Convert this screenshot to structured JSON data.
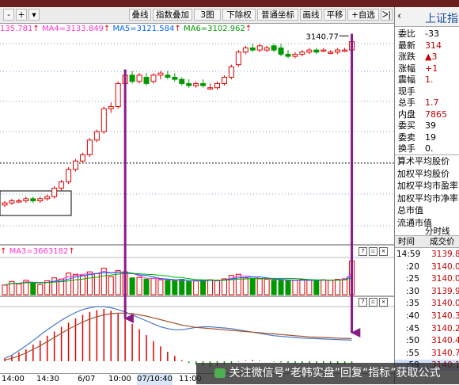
{
  "toolbar": {
    "minus": "-",
    "plus": "+",
    "buttons": [
      "叠线",
      "指数叠加",
      "3图",
      "下除权",
      "普通坐标",
      "画线",
      "平移",
      "+自选",
      "ᐳ|"
    ]
  },
  "legend": {
    "ma3": "135.781",
    "ma4": "MA4=3133.849",
    "ma5": "MA5=3121.584",
    "ma6": "MA6=3102.962",
    "high_label": "3140.77"
  },
  "volume_legend": {
    "ma3": "MA3=3663182"
  },
  "x_axis_labels": [
    "14:00",
    "14:30",
    "6/07",
    "10:00",
    "07/10:40",
    "11:00"
  ],
  "right_panel": {
    "title": "上证指",
    "rows": [
      {
        "label": "委比",
        "value": "-33"
      },
      {
        "label": "最新",
        "value": "314"
      },
      {
        "label": "涨跌",
        "value": "▲3"
      },
      {
        "label": "涨幅",
        "value": "+1"
      },
      {
        "label": "震幅",
        "value": "1."
      },
      {
        "label": "现手",
        "value": ""
      },
      {
        "label": "总手",
        "value": "1.7"
      },
      {
        "label": "内盘",
        "value": "7865"
      },
      {
        "label": "委买",
        "value": "39"
      },
      {
        "label": "委卖",
        "value": "19"
      },
      {
        "label": "换手",
        "value": "0."
      }
    ],
    "info": [
      "算术平均股价",
      "加权平均股价",
      "加权平均市盈率",
      "加权平均市净率",
      "总市值",
      "流通市值"
    ],
    "ticks_title": "分时线",
    "ticks_header": {
      "time": "时间",
      "price": "成交价"
    },
    "ticks": [
      {
        "time": "14:59",
        "price": "3139.8"
      },
      {
        "time": ":20",
        "price": "3140.0"
      },
      {
        "time": ":25",
        "price": "3140.0"
      },
      {
        "time": ":30",
        "price": "3139.9"
      },
      {
        "time": ":35",
        "price": "3140.0"
      },
      {
        "time": ":40",
        "price": "3140.3"
      },
      {
        "time": ":45",
        "price": "3140.2"
      },
      {
        "time": ":50",
        "price": "3140.4"
      },
      {
        "time": ":55",
        "price": "3140.7"
      },
      {
        "time": ":59",
        "price": "3140.1"
      }
    ]
  },
  "watermark": {
    "text": "关注微信号“老韩实盘”回复“指标”获取公式"
  },
  "colors": {
    "up": "#e00000",
    "down": "#009a00",
    "ma_pink": "#ff33cc",
    "ma_blue": "#0066ff",
    "ma_green": "#00aa00",
    "arrow": "#8a1a8a"
  },
  "chart_data": {
    "type": "candlestick",
    "candles": [
      [
        3060,
        3062,
        3059,
        3061
      ],
      [
        3061,
        3063,
        3060,
        3062
      ],
      [
        3062,
        3063,
        3061,
        3062
      ],
      [
        3062,
        3064,
        3061,
        3063
      ],
      [
        3063,
        3064,
        3061,
        3062
      ],
      [
        3062,
        3064,
        3061,
        3063
      ],
      [
        3063,
        3065,
        3062,
        3064
      ],
      [
        3064,
        3069,
        3063,
        3068
      ],
      [
        3068,
        3072,
        3067,
        3071
      ],
      [
        3071,
        3078,
        3070,
        3077
      ],
      [
        3077,
        3082,
        3076,
        3081
      ],
      [
        3081,
        3085,
        3080,
        3084
      ],
      [
        3084,
        3092,
        3083,
        3091
      ],
      [
        3091,
        3096,
        3090,
        3095
      ],
      [
        3095,
        3107,
        3094,
        3106
      ],
      [
        3106,
        3109,
        3104,
        3107
      ],
      [
        3107,
        3119,
        3106,
        3118
      ],
      [
        3118,
        3124,
        3116,
        3122
      ],
      [
        3122,
        3124,
        3118,
        3119
      ],
      [
        3119,
        3123,
        3118,
        3122
      ],
      [
        3121,
        3123,
        3117,
        3118
      ],
      [
        3119,
        3123,
        3118,
        3122
      ],
      [
        3122,
        3124,
        3120,
        3123
      ],
      [
        3122,
        3124,
        3120,
        3121
      ],
      [
        3121,
        3123,
        3119,
        3120
      ],
      [
        3120,
        3121,
        3117,
        3118
      ],
      [
        3118,
        3120,
        3116,
        3117
      ],
      [
        3117,
        3119,
        3116,
        3118
      ],
      [
        3118,
        3120,
        3116,
        3117
      ],
      [
        3116,
        3118,
        3115,
        3116
      ],
      [
        3116,
        3119,
        3115,
        3118
      ],
      [
        3118,
        3122,
        3117,
        3121
      ],
      [
        3121,
        3127,
        3120,
        3126
      ],
      [
        3127,
        3134,
        3126,
        3133
      ],
      [
        3133,
        3136,
        3132,
        3135
      ],
      [
        3135,
        3137,
        3133,
        3134
      ],
      [
        3134,
        3137,
        3133,
        3136
      ],
      [
        3134,
        3136,
        3133,
        3135
      ],
      [
        3136,
        3137,
        3133,
        3134
      ],
      [
        3135,
        3137,
        3131,
        3132
      ],
      [
        3132,
        3134,
        3130,
        3131
      ],
      [
        3131,
        3133,
        3130,
        3132
      ],
      [
        3132,
        3134,
        3131,
        3133
      ],
      [
        3133,
        3135,
        3132,
        3134
      ],
      [
        3134,
        3135,
        3132,
        3133
      ],
      [
        3134,
        3135,
        3133,
        3134
      ],
      [
        3133,
        3134,
        3132,
        3133
      ],
      [
        3133,
        3135,
        3132,
        3134
      ],
      [
        3134,
        3135,
        3133,
        3134
      ],
      [
        3134,
        3141,
        3133,
        3138
      ]
    ],
    "volume": [
      40,
      55,
      45,
      60,
      50,
      42,
      58,
      70,
      65,
      90,
      85,
      80,
      95,
      88,
      110,
      75,
      100,
      95,
      70,
      72,
      65,
      68,
      62,
      60,
      58,
      64,
      55,
      57,
      60,
      62,
      58,
      66,
      80,
      85,
      70,
      68,
      66,
      64,
      60,
      62,
      58,
      60,
      63,
      60,
      58,
      62,
      60,
      64,
      66,
      140
    ],
    "macd": [
      0.5,
      1,
      1.5,
      2,
      2.8,
      3.5,
      4.3,
      5,
      5.8,
      6.5,
      7.2,
      7.8,
      8.3,
      8.6,
      8.8,
      8.5,
      8,
      7.2,
      6.3,
      5.4,
      4.4,
      3.4,
      2.5,
      1.6,
      0.9,
      0.2,
      -0.3,
      -0.6,
      -0.8,
      -0.9,
      -0.8,
      -0.6,
      -0.4,
      -0.1,
      0.1,
      0.2,
      0.1,
      0,
      -0.1,
      -0.2,
      -0.3,
      -0.35,
      -0.4,
      -0.42,
      -0.45,
      -0.46,
      -0.48,
      -0.5,
      -0.5,
      -0.5
    ],
    "dif": [
      0.5,
      1,
      1.8,
      2.6,
      3.5,
      4.4,
      5.3,
      6.1,
      6.9,
      7.6,
      8.2,
      8.7,
      9,
      9.2,
      9.2,
      9,
      8.7,
      8.3,
      7.8,
      7.3,
      6.8,
      6.3,
      5.8,
      5.5,
      5.3,
      5.3,
      5.5,
      5.7,
      5.8,
      5.8,
      5.7,
      5.6,
      5.5,
      5.3,
      5.1,
      4.9,
      4.7,
      4.5,
      4.3,
      4.2,
      4.1,
      4,
      3.9,
      3.85,
      3.8,
      3.75,
      3.7,
      3.65,
      3.6,
      3.55
    ],
    "dea": [
      0.2,
      0.5,
      0.9,
      1.4,
      2,
      2.6,
      3.3,
      4,
      4.7,
      5.4,
      6,
      6.6,
      7.1,
      7.5,
      7.8,
      8,
      8.1,
      8.1,
      8,
      7.8,
      7.6,
      7.3,
      7,
      6.7,
      6.4,
      6.1,
      5.9,
      5.7,
      5.6,
      5.5,
      5.4,
      5.3,
      5.2,
      5.1,
      5,
      4.9,
      4.8,
      4.7,
      4.6,
      4.5,
      4.4,
      4.3,
      4.2,
      4.1,
      4.05,
      4,
      3.95,
      3.9,
      3.85,
      3.8
    ],
    "high": 3140.77
  }
}
